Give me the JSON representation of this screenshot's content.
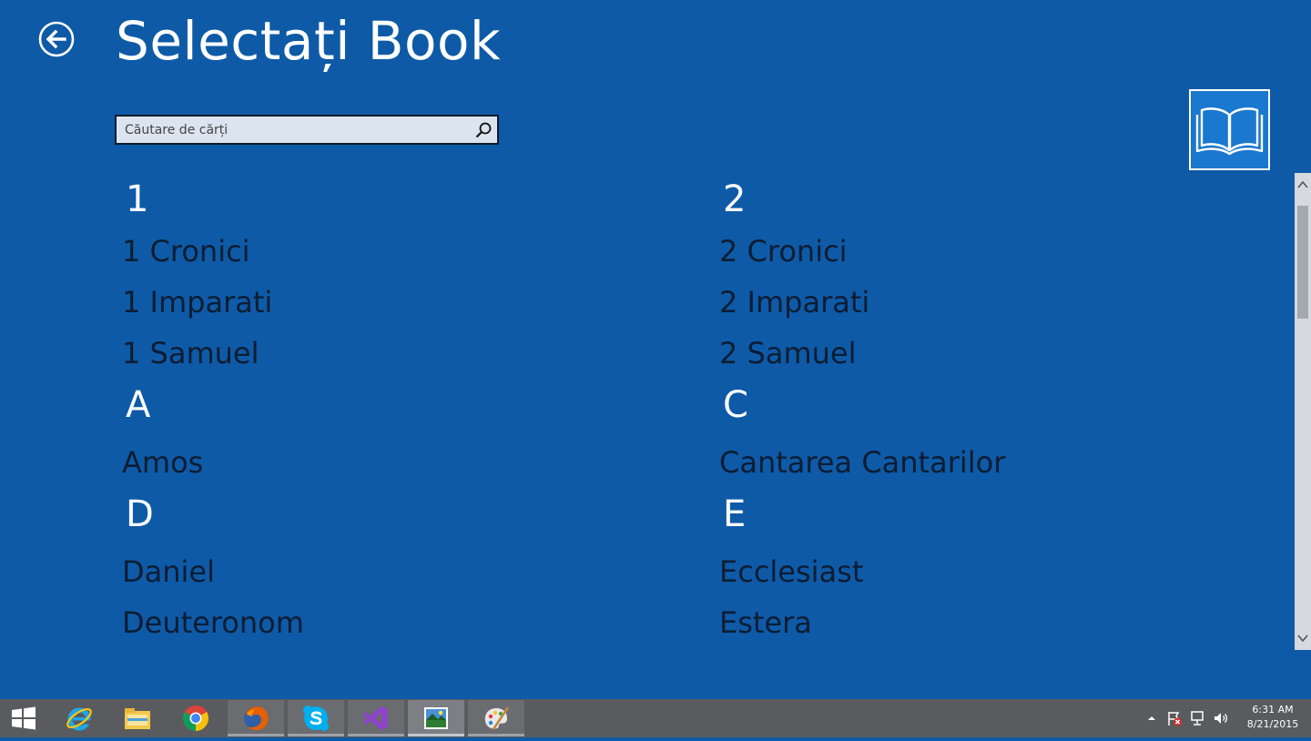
{
  "app": {
    "title": "Selectați Book",
    "search": {
      "placeholder": "Căutare de cărți",
      "value": ""
    }
  },
  "books": {
    "left": {
      "group1": {
        "header": "1",
        "items": [
          "1 Cronici",
          "1 Imparati",
          "1 Samuel"
        ]
      },
      "group2": {
        "header": "A",
        "items": [
          "Amos"
        ]
      },
      "group3": {
        "header": "D",
        "items": [
          "Daniel",
          "Deuteronom"
        ]
      }
    },
    "right": {
      "group1": {
        "header": "2",
        "items": [
          "2 Cronici",
          "2 Imparati",
          "2 Samuel"
        ]
      },
      "group2": {
        "header": "C",
        "items": [
          "Cantarea Cantarilor"
        ]
      },
      "group3": {
        "header": "E",
        "items": [
          "Ecclesiast",
          "Estera"
        ]
      }
    }
  },
  "taskbar": {
    "apps": [
      {
        "name": "Internet Explorer",
        "icon": "internet-explorer-icon"
      },
      {
        "name": "File Explorer",
        "icon": "file-explorer-icon"
      },
      {
        "name": "Google Chrome",
        "icon": "chrome-icon"
      },
      {
        "name": "Firefox",
        "icon": "firefox-icon"
      },
      {
        "name": "Skype",
        "icon": "skype-icon"
      },
      {
        "name": "Visual Studio",
        "icon": "visual-studio-icon"
      },
      {
        "name": "Bible app",
        "icon": "landscape-app-icon"
      },
      {
        "name": "Paint",
        "icon": "paint-icon"
      }
    ],
    "clock": {
      "time": "6:31 AM",
      "date": "8/21/2015"
    }
  },
  "colors": {
    "background": "#0e5aa7",
    "item_text": "#0c1d33",
    "header_text": "#ffffff",
    "taskbar": "#5a5b5e"
  }
}
